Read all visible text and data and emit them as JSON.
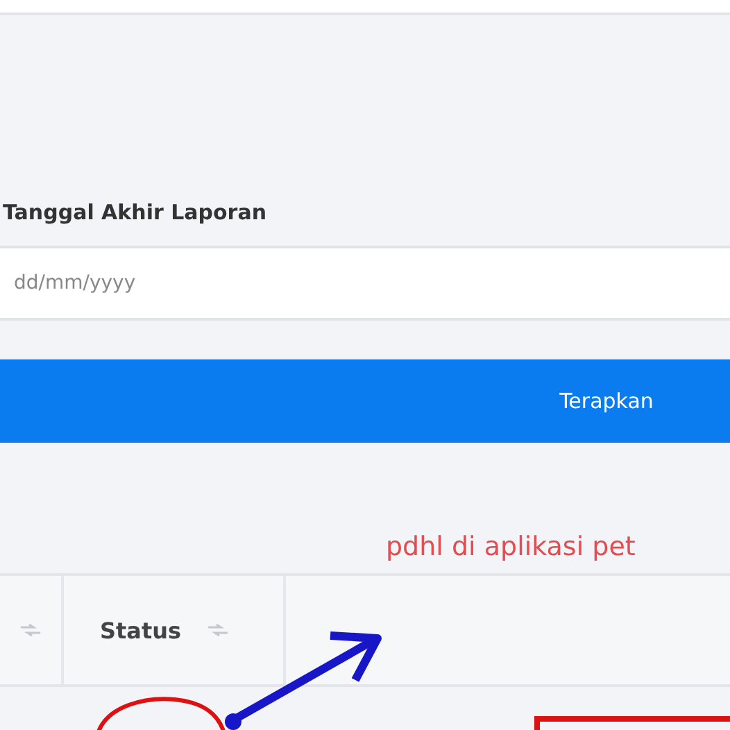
{
  "filter": {
    "label": "Tanggal Akhir Laporan",
    "date_field": {
      "placeholder": "dd/mm/yyyy"
    },
    "apply_button": "Terapkan"
  },
  "annotation": {
    "note": "pdhl di aplikasi pet"
  },
  "table": {
    "columns": [
      {
        "sortable": true
      },
      {
        "label": "Status",
        "sortable": true
      }
    ]
  }
}
